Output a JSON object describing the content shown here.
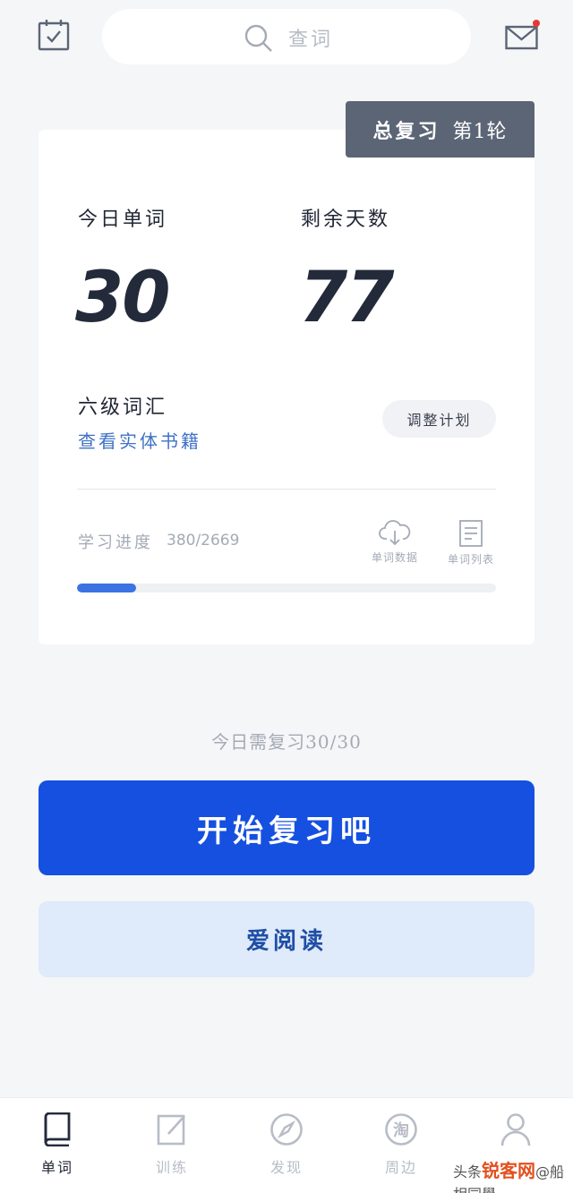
{
  "topbar": {
    "search_placeholder": "查词",
    "mail_has_badge": true
  },
  "plan": {
    "round_title": "总复习",
    "round_label": "第1轮",
    "today_words_label": "今日单词",
    "today_words_value": "30",
    "days_left_label": "剩余天数",
    "days_left_value": "77",
    "vocab_name": "六级词汇",
    "book_link": "查看实体书籍",
    "adjust_label": "调整计划",
    "progress_label": "学习进度",
    "progress_count": "380/2669",
    "progress_fraction": 0.142,
    "tool_download_label": "单词数据",
    "tool_list_label": "单词列表"
  },
  "review": {
    "count_text": "今日需复习30/30",
    "start_label": "开始复习吧",
    "read_label": "爱阅读"
  },
  "nav": {
    "items": [
      {
        "label": "单词",
        "icon": "book-icon",
        "active": true
      },
      {
        "label": "训练",
        "icon": "edit-icon",
        "active": false
      },
      {
        "label": "发现",
        "icon": "compass-icon",
        "active": false
      },
      {
        "label": "周边",
        "icon": "taobao-icon",
        "active": false
      },
      {
        "label": "",
        "icon": "person-icon",
        "active": false
      }
    ]
  },
  "watermark": {
    "source": "头条",
    "brand": "锐客网",
    "author": "@船相同學"
  },
  "colors": {
    "accent": "#1550e0",
    "progress": "#3b73e3",
    "link": "#3f72c6",
    "badge": "#e53935"
  }
}
